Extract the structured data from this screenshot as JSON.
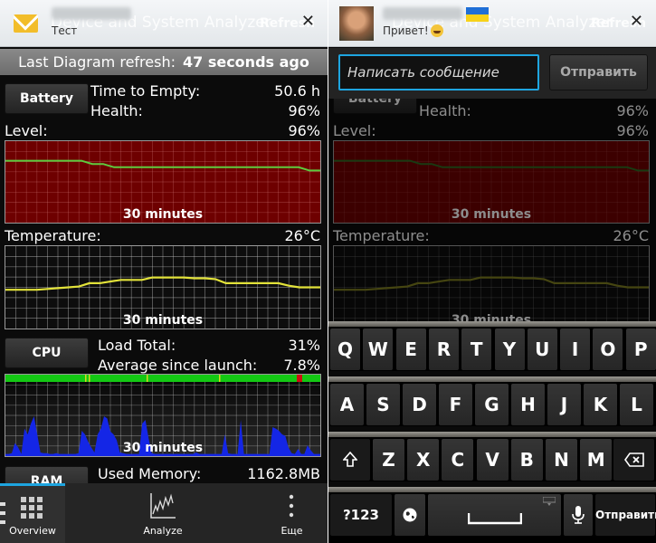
{
  "app": {
    "title_ghost": "Device and System Analyzer",
    "refresh_ghost": "Refresh"
  },
  "left_notification": {
    "icon": "envelope-icon",
    "sender": "blurred",
    "message": "Тест",
    "close": "✕"
  },
  "right_notification": {
    "icon": "avatar",
    "sender": "blurred",
    "flag": "ukraine-flag",
    "message": "Привет!",
    "emoji": "laughing-emoji",
    "close": "✕"
  },
  "refresh_bar": {
    "label": "Last Diagram refresh:",
    "value": "47 seconds ago"
  },
  "battery": {
    "button": "Battery",
    "time_to_empty_label": "Time to Empty:",
    "time_to_empty_value": "50.6 h",
    "health_label": "Health:",
    "health_value": "96%",
    "level_label": "Level:",
    "level_value": "96%",
    "chart_caption": "30 minutes",
    "level_series_percent": [
      97,
      97,
      97,
      97,
      97,
      97,
      97,
      97,
      96.5,
      96.5,
      96,
      96,
      96,
      96,
      96,
      96,
      96,
      96,
      96,
      96,
      96,
      96,
      96,
      96,
      96,
      96,
      96,
      96,
      95.5,
      95.5
    ]
  },
  "temperature": {
    "label": "Temperature:",
    "value": "26°C",
    "chart_caption": "30 minutes",
    "series": [
      0.47,
      0.47,
      0.47,
      0.47,
      0.48,
      0.49,
      0.5,
      0.51,
      0.55,
      0.55,
      0.57,
      0.59,
      0.59,
      0.59,
      0.62,
      0.62,
      0.62,
      0.62,
      0.61,
      0.61,
      0.6,
      0.55,
      0.55,
      0.55,
      0.55,
      0.55,
      0.55,
      0.52,
      0.5,
      0.5,
      0.5
    ]
  },
  "cpu": {
    "button": "CPU",
    "load_total_label": "Load Total:",
    "load_total_value": "31%",
    "average_label": "Average since launch:",
    "average_value": "7.8%",
    "chart_caption": "30 minutes",
    "load_series": [
      0.03,
      0.03,
      0.04,
      0.18,
      0.12,
      0.03,
      0.38,
      0.3,
      0.45,
      0.55,
      0.3,
      0.05,
      0.04,
      0.04,
      0.03,
      0.03,
      0.04,
      0.03,
      0.03,
      0.03,
      0.03,
      0.03,
      0.03,
      0.04,
      0.35,
      0.3,
      0.2,
      0.12,
      0.05,
      0.3,
      0.38,
      0.55,
      0.52,
      0.34,
      0.3,
      0.22,
      0.05,
      0.04,
      0.03,
      0.03,
      0.03,
      0.03,
      0.03,
      0.45,
      0.5,
      0.25,
      0.04,
      0.03,
      0.03,
      0.03,
      0.03,
      0.03,
      0.03,
      0.03,
      0.03,
      0.03,
      0.03,
      0.03,
      0.03,
      0.03,
      0.05,
      0.03,
      0.03,
      0.03,
      0.03,
      0.03,
      0.03,
      0.03,
      0.03,
      0.3,
      0.04,
      0.03,
      0.03,
      0.03,
      0.5,
      0.03,
      0.03,
      0.03,
      0.03,
      0.03,
      0.03,
      0.03,
      0.03,
      0.03,
      0.4,
      0.38,
      0.35,
      0.3,
      0.28,
      0.12,
      0.04,
      0.03,
      0.1,
      0.03,
      0.03,
      0.15,
      0.08,
      0.03,
      0.03,
      0.03
    ]
  },
  "ram": {
    "button": "RAM",
    "used_memory_label": "Used Memory:",
    "used_memory_value": "1162.8MB"
  },
  "bottom_nav": {
    "items": [
      {
        "label": "Overview",
        "icon": "grid-icon",
        "active": true
      },
      {
        "label": "Analyze",
        "icon": "line-chart-icon",
        "active": false
      },
      {
        "label": "Еще",
        "icon": "more-vertical-icon",
        "active": false
      }
    ]
  },
  "compose": {
    "placeholder": "Написать сообщение",
    "value": "",
    "send_label": "Отправить"
  },
  "keyboard": {
    "row1": [
      "Q",
      "W",
      "E",
      "R",
      "T",
      "Y",
      "U",
      "I",
      "O",
      "P"
    ],
    "row2": [
      "A",
      "S",
      "D",
      "F",
      "G",
      "H",
      "J",
      "K",
      "L"
    ],
    "row3": [
      "Z",
      "X",
      "C",
      "V",
      "B",
      "N",
      "M"
    ],
    "shift": "⇧",
    "backspace": "⌫",
    "symbols": "?123",
    "language": "globe-icon",
    "space": "␣",
    "mic": "microphone-icon",
    "send": "Отправить"
  },
  "colors": {
    "accent": "#1ea5e0",
    "battery_fill": "#6e0000",
    "battery_line": "#5ecb3e",
    "temp_line": "#e2e23a",
    "cpu_fill": "#1426e6",
    "cpu_status_green": "#14c814",
    "cpu_status_red": "#cc1010"
  }
}
